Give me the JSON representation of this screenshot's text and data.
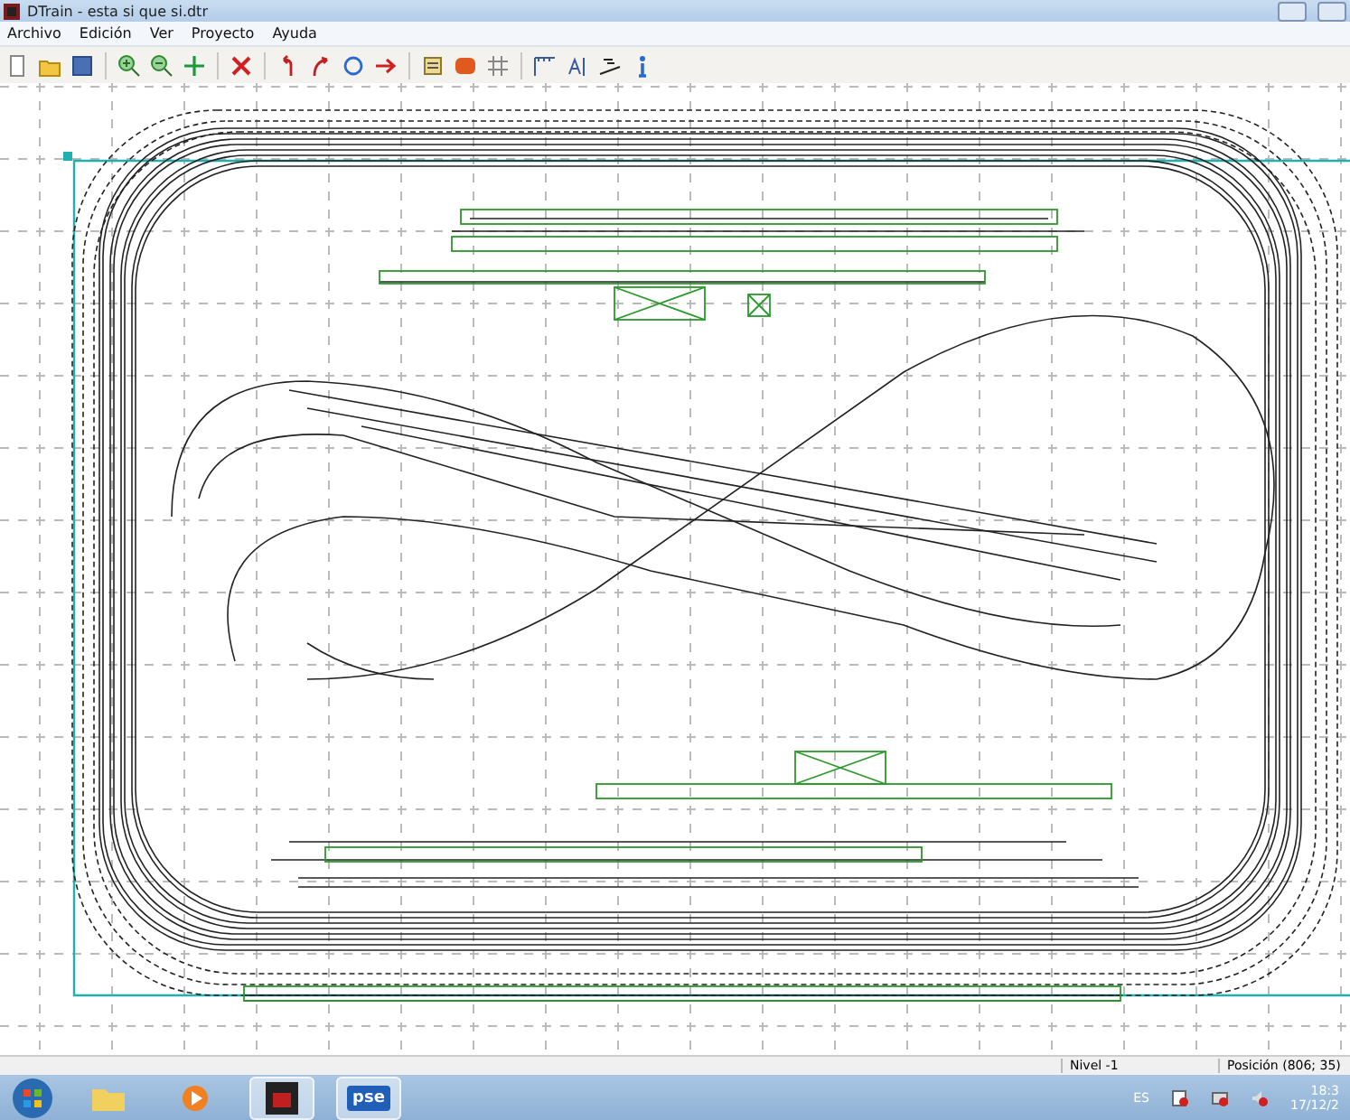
{
  "window": {
    "title": "DTrain - esta si que si.dtr"
  },
  "menu": [
    "Archivo",
    "Edición",
    "Ver",
    "Proyecto",
    "Ayuda"
  ],
  "status_bar": {
    "level": "Nivel -1",
    "position": "Posición (806; 35)"
  },
  "taskbar": {
    "app_label": "pse",
    "language": "ES",
    "time": "18:3",
    "date": "17/12/2"
  }
}
